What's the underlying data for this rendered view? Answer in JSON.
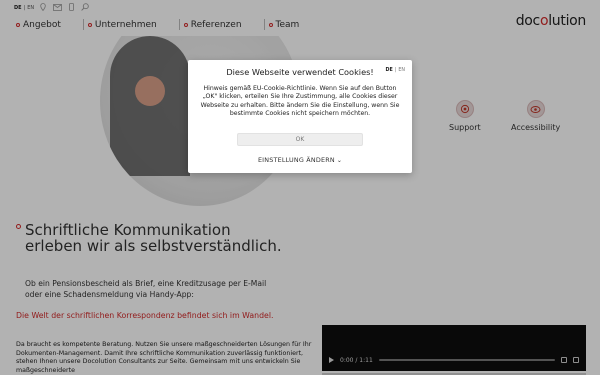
{
  "header": {
    "language": {
      "active": "DE",
      "inactive": "EN"
    },
    "icons": [
      "location-icon",
      "mail-icon",
      "phone-icon",
      "search-icon"
    ],
    "nav": [
      "Angebot",
      "Unternehmen",
      "Referenzen",
      "Team"
    ],
    "logo": {
      "pre": "doc",
      "accent": "o",
      "post": "lution"
    }
  },
  "hero": {
    "quick_links": [
      {
        "label": "Support",
        "icon": "support-icon"
      },
      {
        "label": "Accessibility",
        "icon": "accessibility-icon"
      }
    ]
  },
  "main": {
    "headline": "Schriftliche Kommunikation erleben wir als selbstverständlich.",
    "intro": "Ob ein Pensionsbescheid als Brief, eine Kreditzusage per E-Mail oder eine Schadensmeldung via Handy-App:",
    "highlight": "Die Welt der schriftlichen Korrespondenz befindet sich im Wandel.",
    "body": "Da braucht es kompetente Beratung. Nutzen Sie unsere maßgeschneiderten Lösungen für Ihr Dokumenten-Management. Damit Ihre schriftliche Kommunikation zuverlässig funktioniert, stehen Ihnen unsere Docolution Consultants zur Seite. Gemeinsam mit uns entwickeln Sie maßgeschneiderte",
    "video": {
      "time": "0:00 / 1:11"
    }
  },
  "cookie_modal": {
    "title": "Diese Webseite verwendet Cookies!",
    "language": {
      "active": "DE",
      "inactive": "EN"
    },
    "text": "Hinweis gemäß EU-Cookie-Richtlinie. Wenn Sie auf den Button „OK\" klicken, erteilen Sie Ihre Zustimmung, alle Cookies dieser Webseite zu erhalten. Bitte ändern Sie die Einstellung, wenn Sie bestimmte Cookies nicht speichern möchten.",
    "ok_label": "OK",
    "settings_label": "EINSTELLUNG ÄNDERN"
  },
  "colors": {
    "accent": "#d12a2a",
    "overlay": "rgba(0,0,0,0.3)"
  }
}
